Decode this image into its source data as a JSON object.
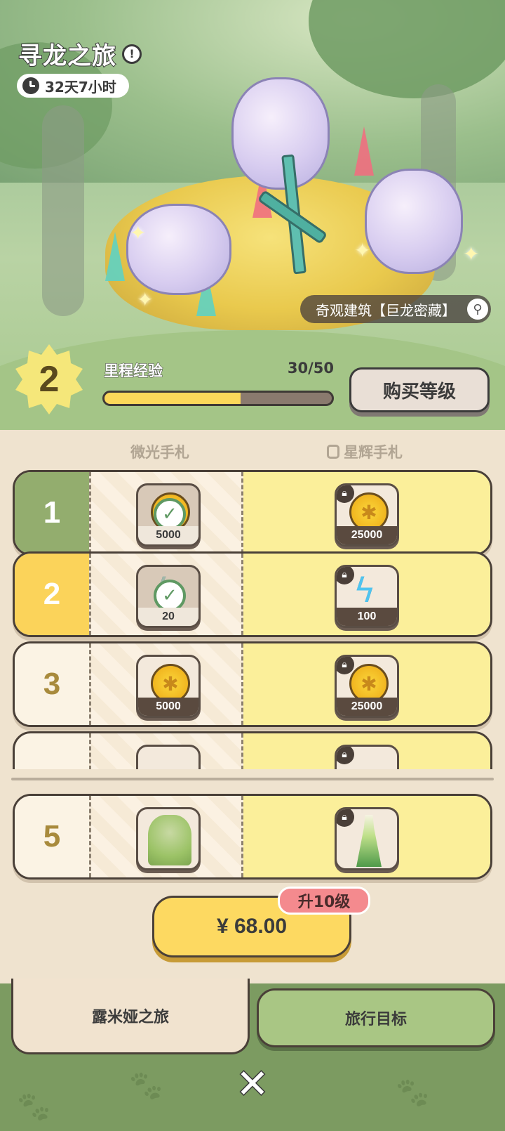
{
  "event": {
    "title": "寻龙之旅",
    "time_left": "32天7小时",
    "wonder_label": "奇观建筑【巨龙密藏】"
  },
  "progress": {
    "level": "2",
    "exp_label": "里程经验",
    "exp_text": "30/50",
    "exp_fraction": 0.6,
    "buy_level_label": "购买等级"
  },
  "columns": {
    "free": "微光手札",
    "premium": "星辉手札"
  },
  "rows": [
    {
      "level": "1",
      "free_qty": "5000",
      "paid_qty": "25000"
    },
    {
      "level": "2",
      "free_qty": "20",
      "paid_qty": "100"
    },
    {
      "level": "3",
      "free_qty": "5000",
      "paid_qty": "25000"
    },
    {
      "level": "5",
      "free_qty": "",
      "paid_qty": ""
    }
  ],
  "purchase": {
    "price": "¥ 68.00",
    "tag": "升10级"
  },
  "tabs": {
    "journey": "露米娅之旅",
    "goals": "旅行目标"
  },
  "icons": {
    "close": "close-icon",
    "lock": "lock-icon",
    "check": "checkmark-icon",
    "magnify": "magnifier-icon"
  },
  "colors": {
    "claimed_level": "#93ad6e",
    "current_level": "#fbd35a",
    "premium_bg": "#fbef9a",
    "price_button": "#fdd961",
    "upgrade_tag": "#f48a8e"
  }
}
